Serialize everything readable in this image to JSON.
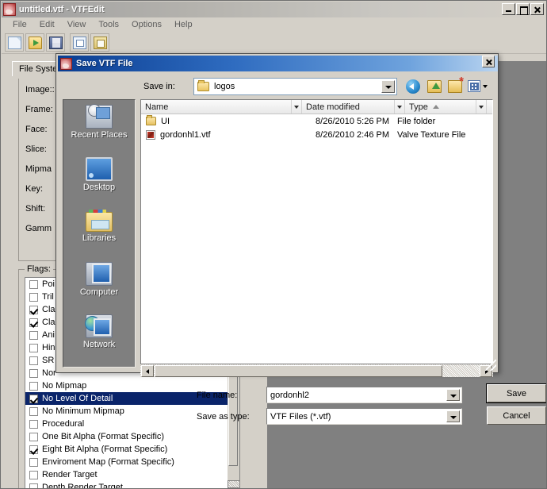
{
  "app": {
    "title": "untitled.vtf - VTFEdit",
    "icon": "vtfedit-icon",
    "menu": [
      "File",
      "Edit",
      "View",
      "Tools",
      "Options",
      "Help"
    ],
    "toolbar": [
      {
        "name": "new-file-icon",
        "tip": "New"
      },
      {
        "name": "open-file-icon",
        "tip": "Open"
      },
      {
        "name": "save-file-icon",
        "tip": "Save"
      },
      {
        "name": "copy-icon",
        "tip": "Copy"
      },
      {
        "name": "paste-icon",
        "tip": "Paste"
      }
    ],
    "window_buttons": {
      "minimize": "minimize-button",
      "maximize": "maximize-button",
      "close": "close-button"
    }
  },
  "left_panel": {
    "tab_label": "File Syster",
    "group_label": "Image:",
    "properties": [
      "Image::",
      "Frame:",
      "Face:",
      "Slice:",
      "Mipma",
      "Key:",
      "Shift:",
      "Gamm"
    ],
    "flags_legend": "Flags:",
    "flags": [
      {
        "label": "Poi",
        "checked": false,
        "selected": false
      },
      {
        "label": "Tril",
        "checked": false,
        "selected": false
      },
      {
        "label": "Cla",
        "checked": true,
        "selected": false
      },
      {
        "label": "Cla",
        "checked": true,
        "selected": false
      },
      {
        "label": "Ani",
        "checked": false,
        "selected": false
      },
      {
        "label": "Hin",
        "checked": false,
        "selected": false
      },
      {
        "label": "SR",
        "checked": false,
        "selected": false
      },
      {
        "label": "Nor",
        "checked": false,
        "selected": false
      },
      {
        "label": "No Mipmap",
        "checked": false,
        "selected": false
      },
      {
        "label": "No Level Of Detail",
        "checked": true,
        "selected": true
      },
      {
        "label": "No Minimum Mipmap",
        "checked": false,
        "selected": false
      },
      {
        "label": "Procedural",
        "checked": false,
        "selected": false
      },
      {
        "label": "One Bit Alpha (Format Specific)",
        "checked": false,
        "selected": false
      },
      {
        "label": "Eight Bit Alpha (Format Specific)",
        "checked": true,
        "selected": false
      },
      {
        "label": "Enviroment Map (Format Specific)",
        "checked": false,
        "selected": false
      },
      {
        "label": "Render Target",
        "checked": false,
        "selected": false
      },
      {
        "label": "Depth Render Target",
        "checked": false,
        "selected": false
      }
    ]
  },
  "dialog": {
    "title": "Save VTF File",
    "icon": "vtfedit-icon",
    "close_icon": "close-icon",
    "save_in_label": "Save in:",
    "save_in_value": "logos",
    "nav": {
      "back": "back-icon",
      "up": "up-one-level-icon",
      "new_folder": "new-folder-icon",
      "views": "views-icon"
    },
    "places": [
      {
        "label": "Recent Places",
        "icon": "recent-places-icon"
      },
      {
        "label": "Desktop",
        "icon": "desktop-icon"
      },
      {
        "label": "Libraries",
        "icon": "libraries-icon"
      },
      {
        "label": "Computer",
        "icon": "computer-icon"
      },
      {
        "label": "Network",
        "icon": "network-icon"
      }
    ],
    "columns": [
      "Name",
      "Date modified",
      "Type"
    ],
    "sorted_column": "Type",
    "sort_direction": "ascending",
    "files": [
      {
        "name": "UI",
        "date": "8/26/2010 5:26 PM",
        "type": "File folder",
        "icon": "folder-icon"
      },
      {
        "name": "gordonhl1.vtf",
        "date": "8/26/2010 2:46 PM",
        "type": "Valve Texture File",
        "icon": "vtf-file-icon"
      }
    ],
    "file_name_label": "File name:",
    "file_name_value": "gordonhl2",
    "save_as_type_label": "Save as type:",
    "save_as_type_value": "VTF Files (*.vtf)",
    "save_button": "Save",
    "cancel_button": "Cancel"
  },
  "colors": {
    "dialog_title_start": "#0a3d91",
    "dialog_title_end": "#b9d4f0",
    "selection": "#0a246a",
    "face": "#d4d0c8",
    "preview_bg": "#808080",
    "places_bg": "#7f7f7f"
  }
}
